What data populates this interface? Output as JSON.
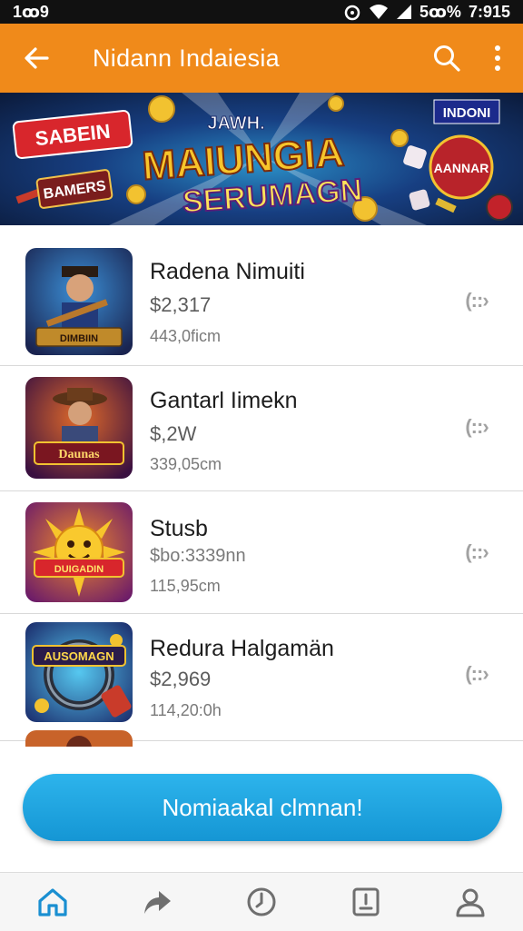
{
  "status_bar": {
    "time": "1ꝏ9",
    "battery": "5ꝏ%",
    "clock": "7:915"
  },
  "app_bar": {
    "title": "Nidann Indaiesia"
  },
  "banner": {
    "headline_top": "JAWH.",
    "headline_main": "MAIUNGIA",
    "headline_sub": "SERUMAGN",
    "left_badge_top": "SABEIN",
    "left_badge_bottom": "BAMERS",
    "right_badge_top": "INDONI",
    "right_badge_mid": "AANNAR"
  },
  "list": [
    {
      "name": "Radena Nimuiti",
      "price": "$2,317",
      "sub": "443,0ficm",
      "thumb_label": "DIMBIIN",
      "more_icon": "ellipsis-chevron-icon"
    },
    {
      "name": "Gantarl Iimekn",
      "price": "$,2W",
      "sub": "339,05cm",
      "thumb_label": "Daunas",
      "more_icon": "ellipsis-chevron-icon"
    },
    {
      "name": "Stusb",
      "price": "$bo:3339nn",
      "sub": "115,95cm",
      "thumb_label": "DUIGADIN",
      "more_icon": "ellipsis-chevron-icon"
    },
    {
      "name": "Redura Halgamän",
      "price": "$2,969",
      "sub": "114,20:0h",
      "thumb_label": "AUSOMAGN",
      "more_icon": "ellipsis-chevron-icon"
    }
  ],
  "cta": {
    "label": "Nomiaakal clmnan!"
  },
  "bottom_nav": [
    {
      "icon": "home-icon",
      "active": true
    },
    {
      "icon": "share-icon",
      "active": false
    },
    {
      "icon": "clock-icon",
      "active": false
    },
    {
      "icon": "document-icon",
      "active": false
    },
    {
      "icon": "profile-icon",
      "active": false
    }
  ],
  "colors": {
    "app_bar": "#f08a1a",
    "cta": "#1596d4",
    "nav_active": "#1a8fd1",
    "nav_inactive": "#6f6f6f"
  }
}
